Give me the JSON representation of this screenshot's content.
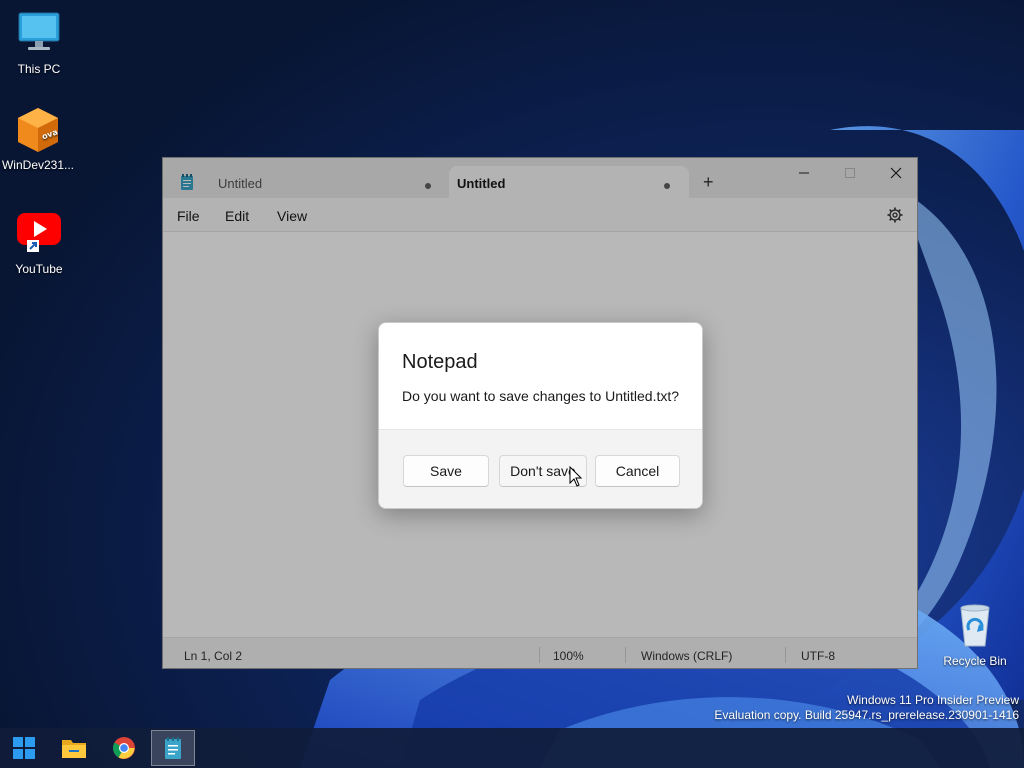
{
  "desktop": {
    "icons": [
      {
        "label": "This PC",
        "icon": "monitor-icon"
      },
      {
        "label": "WinDev231...",
        "icon": "ova-package-icon"
      },
      {
        "label": "YouTube",
        "icon": "youtube-icon"
      },
      {
        "label": "Recycle Bin",
        "icon": "recycle-bin-icon"
      }
    ],
    "watermark": {
      "line1": "Windows 11 Pro Insider Preview",
      "line2": "Evaluation copy. Build 25947.rs_prerelease.230901-1416"
    }
  },
  "notepad": {
    "tabs": [
      {
        "label": "Untitled",
        "active": false,
        "unsaved": true
      },
      {
        "label": "Untitled",
        "active": true,
        "unsaved": true
      }
    ],
    "new_tab_symbol": "+",
    "menu": {
      "file": "File",
      "edit": "Edit",
      "view": "View"
    },
    "status": {
      "position": "Ln 1, Col 2",
      "zoom": "100%",
      "line_ending": "Windows (CRLF)",
      "encoding": "UTF-8"
    }
  },
  "dialog": {
    "title": "Notepad",
    "message": "Do you want to save changes to Untitled.txt?",
    "buttons": {
      "save": "Save",
      "dont_save": "Don't save",
      "cancel": "Cancel"
    }
  },
  "taskbar": {
    "items": [
      "start-icon",
      "file-explorer-icon",
      "chrome-icon",
      "notepad-icon"
    ],
    "active": "notepad-icon"
  },
  "colors": {
    "accent": "#0067c0",
    "desktop_background": "#0b1a3d",
    "youtube_red": "#ff0000"
  }
}
